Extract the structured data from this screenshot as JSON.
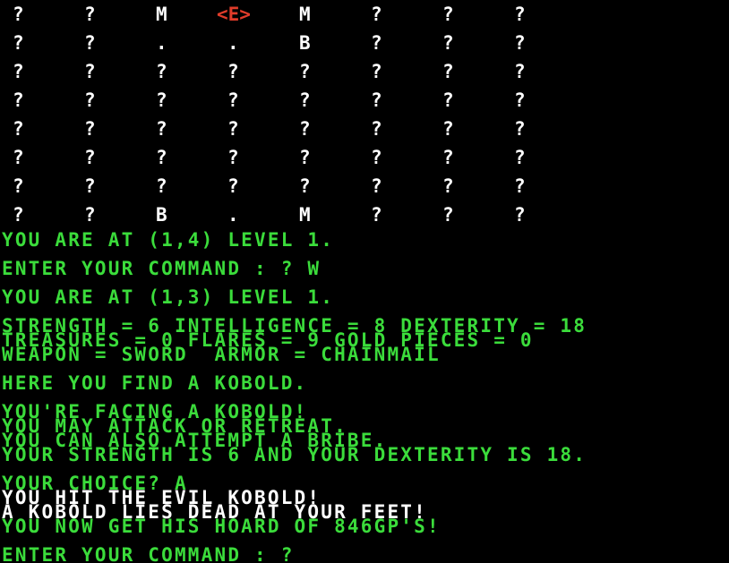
{
  "colors": {
    "background": "#000000",
    "text_green": "#3bdc3b",
    "text_white": "#ffffff",
    "player_marker": "#e03c2a"
  },
  "map": {
    "rows": [
      [
        "?",
        "?",
        "M",
        "<E>",
        "M",
        "?",
        "?",
        "?"
      ],
      [
        "?",
        "?",
        ".",
        ".",
        "B",
        "?",
        "?",
        "?"
      ],
      [
        "?",
        "?",
        "?",
        "?",
        "?",
        "?",
        "?",
        "?"
      ],
      [
        "?",
        "?",
        "?",
        "?",
        "?",
        "?",
        "?",
        "?"
      ],
      [
        "?",
        "?",
        "?",
        "?",
        "?",
        "?",
        "?",
        "?"
      ],
      [
        "?",
        "?",
        "?",
        "?",
        "?",
        "?",
        "?",
        "?"
      ],
      [
        "?",
        "?",
        "?",
        "?",
        "?",
        "?",
        "?",
        "?"
      ],
      [
        "?",
        "?",
        "B",
        ".",
        "M",
        "?",
        "?",
        "?"
      ]
    ],
    "current_cell": "<E>"
  },
  "log": [
    {
      "text": "YOU ARE AT (1,4) LEVEL 1.",
      "color": "green"
    },
    {
      "text": "ENTER YOUR COMMAND : ? W",
      "color": "green"
    },
    {
      "text": "YOU ARE AT (1,3) LEVEL 1.",
      "color": "green"
    },
    {
      "text": "STRENGTH = 6 INTELLIGENCE = 8 DEXTERITY = 18",
      "color": "green"
    },
    {
      "text": "TREASURES = 0 FLARES = 9 GOLD PIECES = 0",
      "color": "green"
    },
    {
      "text": "WEAPON = SWORD  ARMOR = CHAINMAIL",
      "color": "green"
    },
    {
      "text": "HERE YOU FIND A KOBOLD.",
      "color": "green"
    },
    {
      "text": "YOU'RE FACING A KOBOLD!",
      "color": "green"
    },
    {
      "text": "YOU MAY ATTACK OR RETREAT.",
      "color": "green"
    },
    {
      "text": "YOU CAN ALSO ATTEMPT A BRIBE.",
      "color": "green"
    },
    {
      "text": "YOUR STRENGTH IS 6 AND YOUR DEXTERITY IS 18.",
      "color": "green"
    },
    {
      "text": "YOUR CHOICE? A",
      "color": "green"
    },
    {
      "text": "YOU HIT THE EVIL KOBOLD!",
      "color": "white"
    },
    {
      "text": "A KOBOLD LIES DEAD AT YOUR FEET!",
      "color": "white"
    },
    {
      "text": "YOU NOW GET HIS HOARD OF 846GP'S!",
      "color": "green"
    },
    {
      "text": "ENTER YOUR COMMAND : ?",
      "color": "green"
    }
  ]
}
